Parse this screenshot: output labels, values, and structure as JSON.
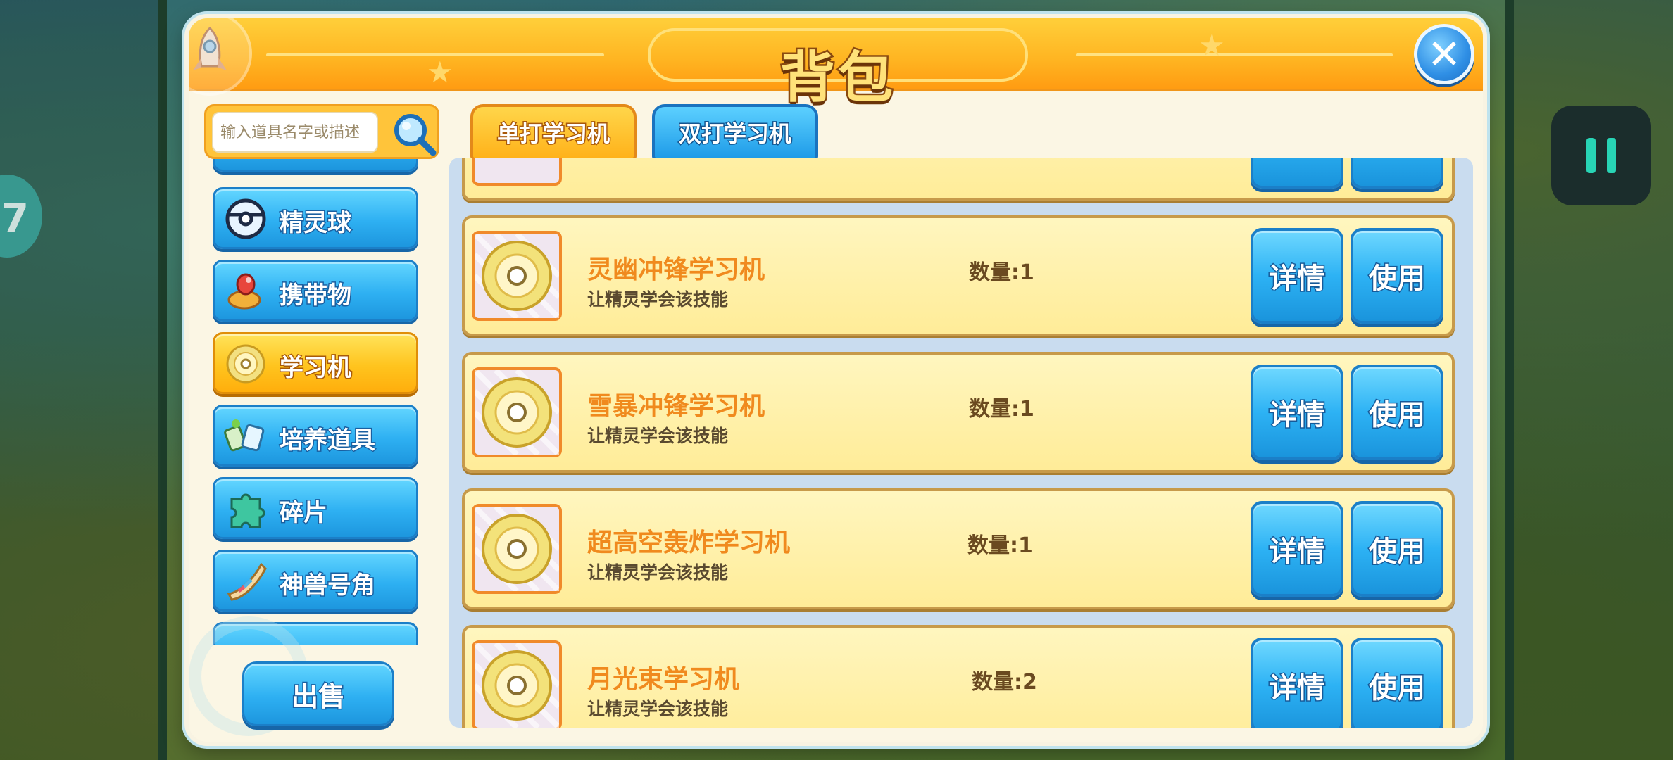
{
  "header": {
    "title": "背包"
  },
  "search": {
    "placeholder": "输入道具名字或描述"
  },
  "sidebar": {
    "items": [
      {
        "label": "精灵球",
        "icon": "pokeball-icon",
        "active": false
      },
      {
        "label": "携带物",
        "icon": "held-item-icon",
        "active": false
      },
      {
        "label": "学习机",
        "icon": "disc-icon",
        "active": true
      },
      {
        "label": "培养道具",
        "icon": "training-items-icon",
        "active": false
      },
      {
        "label": "碎片",
        "icon": "puzzle-piece-icon",
        "active": false
      },
      {
        "label": "神兽号角",
        "icon": "horn-icon",
        "active": false
      }
    ]
  },
  "sell_label": "出售",
  "tabs": [
    {
      "label": "单打学习机",
      "active": true
    },
    {
      "label": "双打学习机",
      "active": false
    }
  ],
  "items": [
    {
      "name": "灵幽冲锋学习机",
      "desc": "让精灵学会该技能",
      "qty": "数量:1"
    },
    {
      "name": "雪暴冲锋学习机",
      "desc": "让精灵学会该技能",
      "qty": "数量:1"
    },
    {
      "name": "超高空轰炸学习机",
      "desc": "让精灵学会该技能",
      "qty": "数量:1"
    },
    {
      "name": "月光束学习机",
      "desc": "让精灵学会该技能",
      "qty": "数量:2"
    }
  ],
  "buttons": {
    "detail": "详情",
    "use": "使用"
  },
  "colors": {
    "header": "#ffb421",
    "primary_button": "#2eb0f2",
    "active_tab": "#ffc41e",
    "item_name": "#f08a1e"
  }
}
